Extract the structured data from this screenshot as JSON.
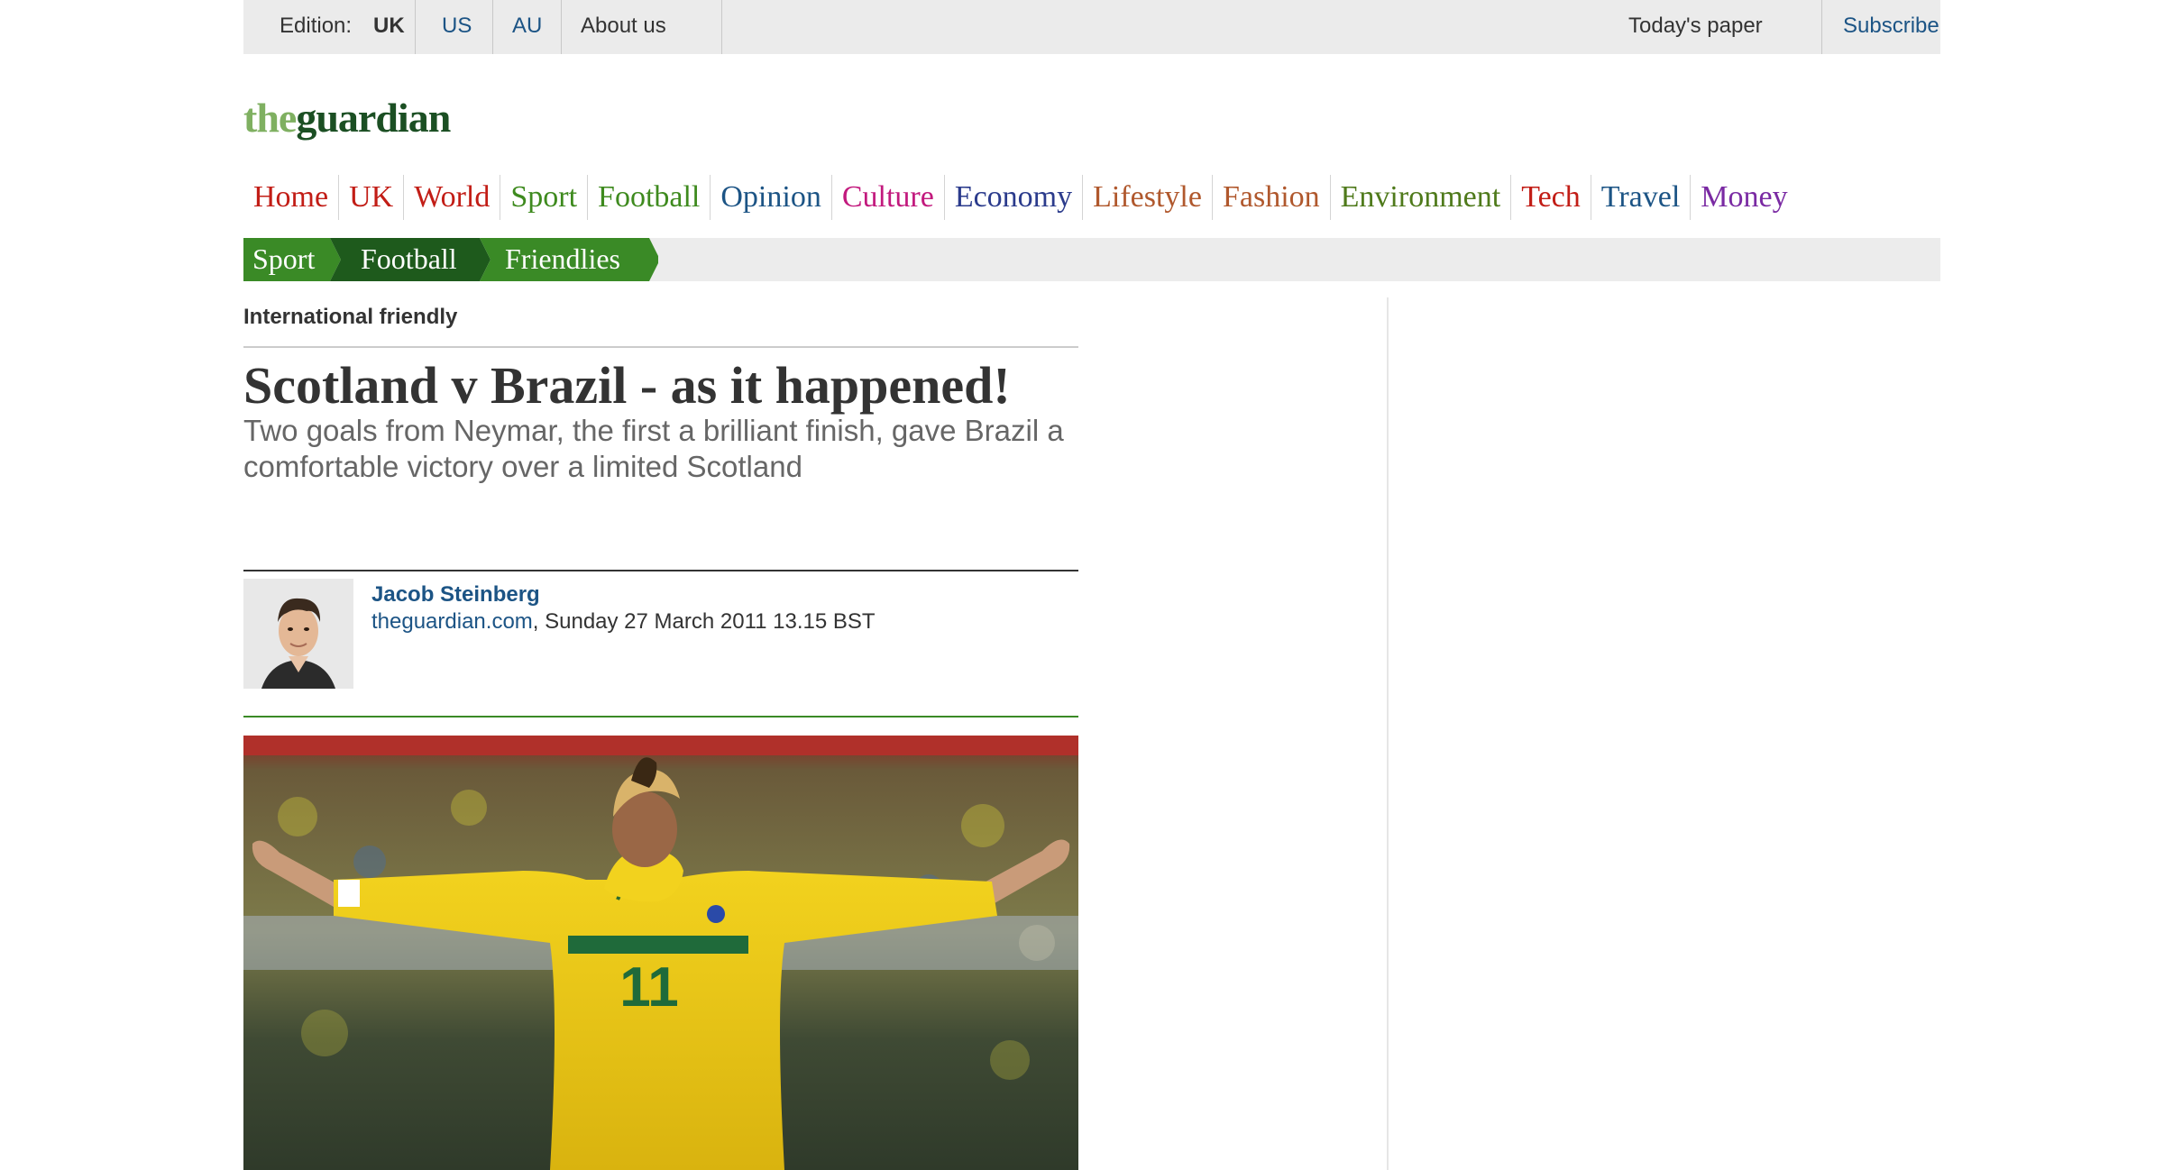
{
  "topbar": {
    "edition_label": "Edition:",
    "editions": [
      {
        "label": "UK",
        "active": true
      },
      {
        "label": "US",
        "active": false
      },
      {
        "label": "AU",
        "active": false
      }
    ],
    "about": "About us",
    "todays_paper": "Today's paper",
    "subscribe": "Subscribe"
  },
  "logo": {
    "the": "the",
    "guardian": "guardian"
  },
  "nav": [
    {
      "label": "Home",
      "color": "#c21d16"
    },
    {
      "label": "UK",
      "color": "#c21d16"
    },
    {
      "label": "World",
      "color": "#c21d16"
    },
    {
      "label": "Sport",
      "color": "#3e8a1e"
    },
    {
      "label": "Football",
      "color": "#3e8a1e"
    },
    {
      "label": "Opinion",
      "color": "#1c5485"
    },
    {
      "label": "Culture",
      "color": "#c2197d"
    },
    {
      "label": "Economy",
      "color": "#2b3b8c"
    },
    {
      "label": "Lifestyle",
      "color": "#b0582d"
    },
    {
      "label": "Fashion",
      "color": "#b0582d"
    },
    {
      "label": "Environment",
      "color": "#4f7a1b"
    },
    {
      "label": "Tech",
      "color": "#c21d16"
    },
    {
      "label": "Travel",
      "color": "#1c5485"
    },
    {
      "label": "Money",
      "color": "#7a2aa3"
    }
  ],
  "breadcrumbs": [
    {
      "label": "Sport",
      "color": "#3a8a26"
    },
    {
      "label": "Football",
      "color": "#1e5a1c"
    },
    {
      "label": "Friendlies",
      "color": "#3a8a26"
    }
  ],
  "article": {
    "kicker": "International friendly",
    "headline": "Scotland v Brazil - as it happened!",
    "standfirst": "Two goals from Neymar, the first a brilliant finish, gave Brazil a comfortable victory over a limited Scotland",
    "author": "Jacob Steinberg",
    "site": "theguardian.com",
    "dateline": ", Sunday 27 March 2011 13.15 BST",
    "shirt_number": "11"
  },
  "colors": {
    "link": "#1c5485",
    "sport_green": "#3a8a26",
    "rule_dark": "#333333",
    "rule_green": "#3a8a26"
  }
}
